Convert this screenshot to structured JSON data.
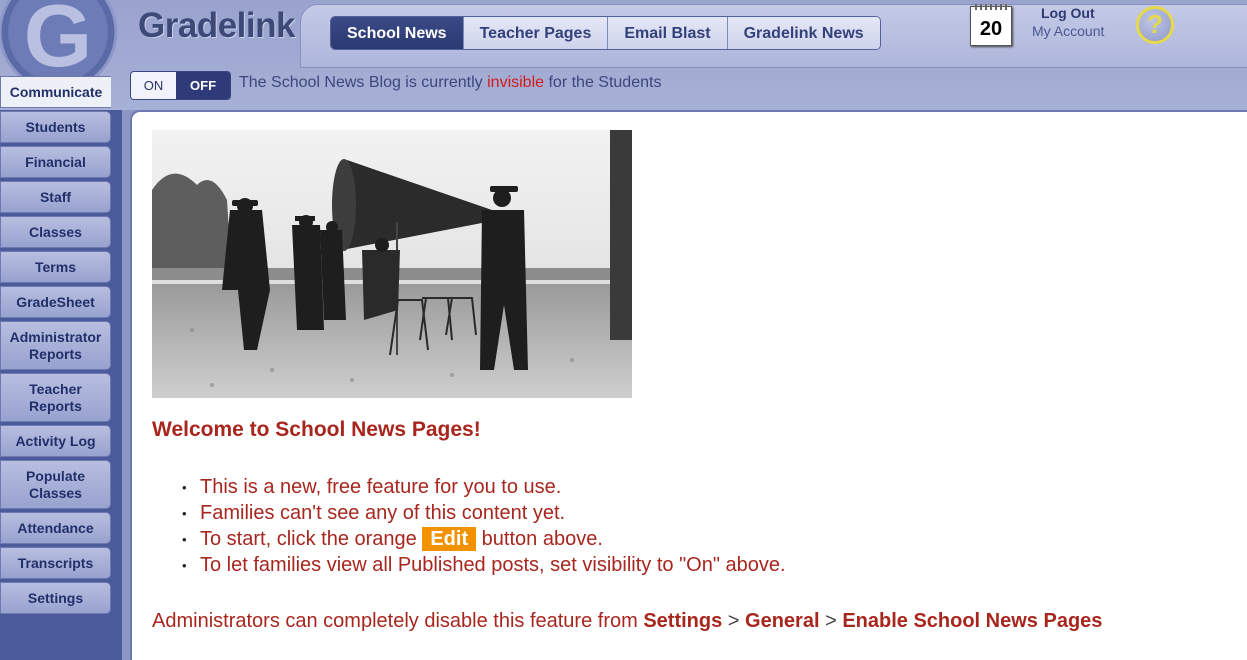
{
  "app": {
    "logo_letter": "G",
    "logo_text": "Gradelink"
  },
  "tabs": [
    {
      "label": "School News",
      "active": true
    },
    {
      "label": "Teacher Pages",
      "active": false
    },
    {
      "label": "Email Blast",
      "active": false
    },
    {
      "label": "Gradelink News",
      "active": false
    }
  ],
  "calendar": {
    "day": "20"
  },
  "account": {
    "logout": "Log Out",
    "my_account": "My Account"
  },
  "help": {
    "label": "?"
  },
  "visibility_toggle": {
    "on_label": "ON",
    "off_label": "OFF",
    "selected": "OFF"
  },
  "visibility_message": {
    "prefix": "The School News Blog is currently ",
    "status": "invisible",
    "suffix": " for the Students"
  },
  "sidebar": {
    "items": [
      {
        "label": "Communicate",
        "active": true
      },
      {
        "label": "Students"
      },
      {
        "label": "Financial"
      },
      {
        "label": "Staff"
      },
      {
        "label": "Classes"
      },
      {
        "label": "Terms"
      },
      {
        "label": "GradeSheet"
      },
      {
        "label": "Administrator Reports"
      },
      {
        "label": "Teacher Reports"
      },
      {
        "label": "Activity Log"
      },
      {
        "label": "Populate Classes"
      },
      {
        "label": "Attendance"
      },
      {
        "label": "Transcripts"
      },
      {
        "label": "Settings"
      }
    ]
  },
  "content": {
    "welcome": "Welcome to School News Pages!",
    "bullets": {
      "b1": "This is a new, free feature for you to use.",
      "b2": "Families can't see any of this content yet.",
      "b3_prefix": "To start, click the orange ",
      "b3_badge": "Edit",
      "b3_suffix": " button above.",
      "b4": "To let families view all Published posts, set visibility to \"On\" above."
    },
    "admin_note": {
      "prefix": "Administrators can completely disable this feature from ",
      "settings": "Settings",
      "sep1": " > ",
      "general": "General",
      "sep2": " > ",
      "enable": "Enable School News Pages"
    }
  },
  "colors": {
    "accent_red": "#a8261e",
    "edit_orange": "#f39200",
    "invisible_red": "#d21c1c",
    "nav_blue": "#2e3b78"
  }
}
